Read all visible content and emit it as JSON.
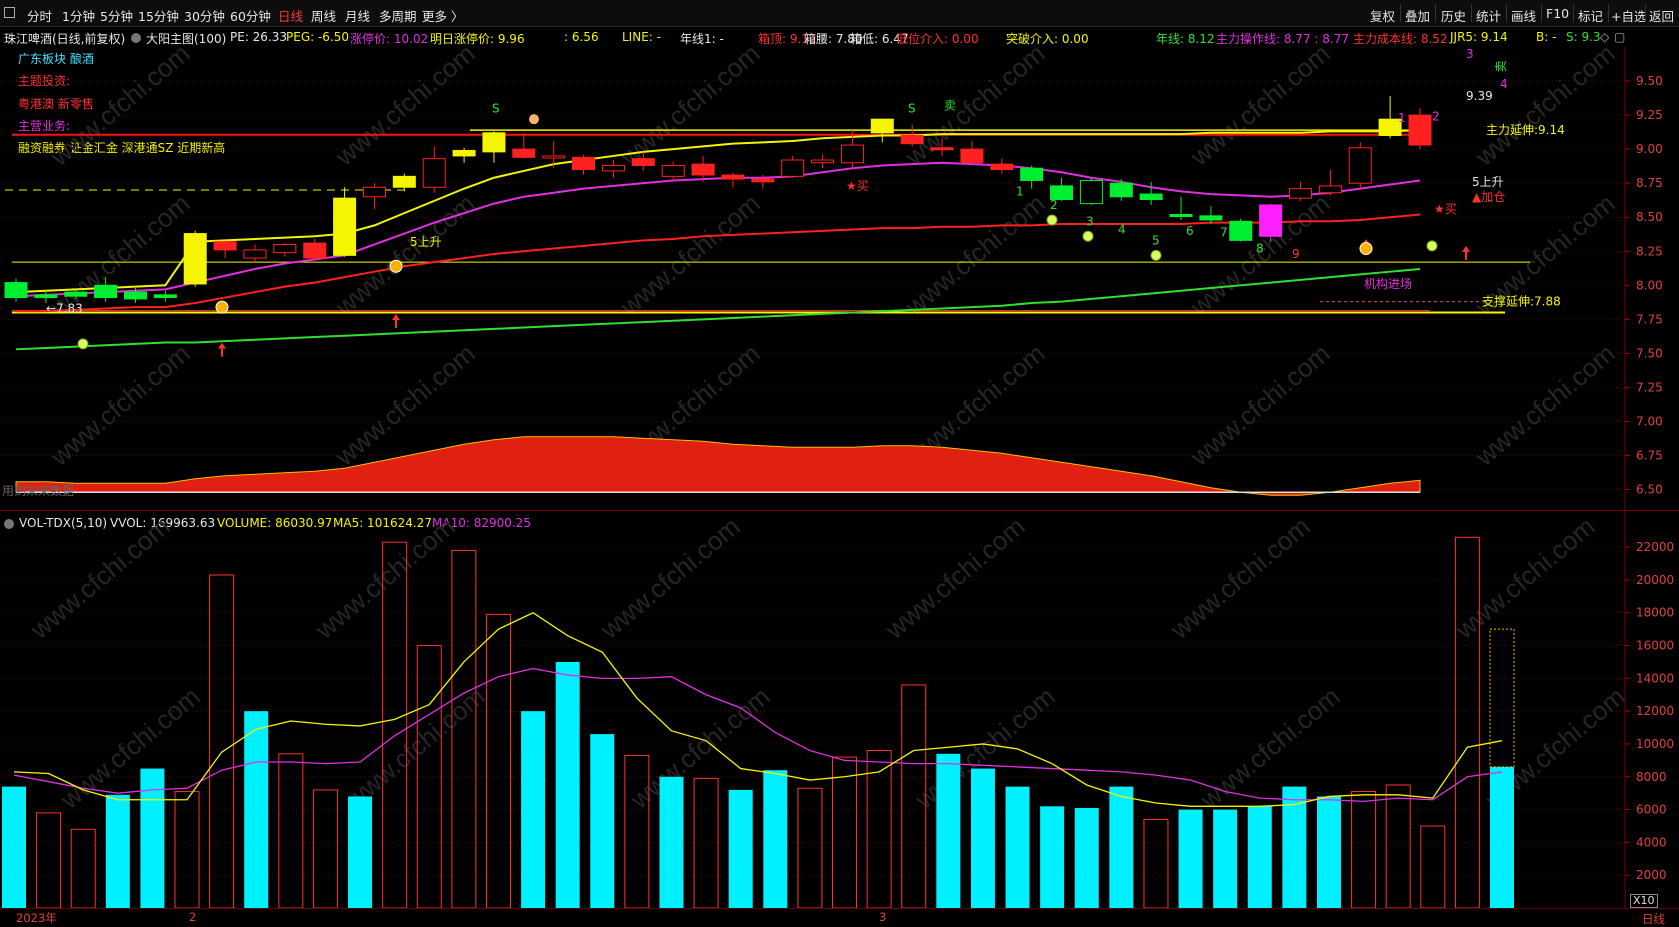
{
  "toolbar": {
    "periods": [
      "分时",
      "1分钟",
      "5分钟",
      "15分钟",
      "30分钟",
      "60分钟",
      "日线",
      "周线",
      "月线",
      "多周期",
      "更多 〉"
    ],
    "active_period": "日线",
    "right": [
      "复权",
      "叠加",
      "历史",
      "统计",
      "画线",
      "F10",
      "标记",
      "+自选",
      "返回"
    ]
  },
  "info": {
    "stock": "珠江啤酒(日线,前复权)",
    "indicator": "大阳主图(100)",
    "pe": "PE: 26.33",
    "peg": "PEG: -6.50",
    "limit_up": "涨停价: 10.02",
    "tomorrow_limit_up": "明日涨停价: 9.96",
    "val656": ": 6.56",
    "line": "LINE: -",
    "year_line1": "年线1: -",
    "box_top": "箱顶: 9.12",
    "box_mid": "箱腰: 7.80",
    "box_low": "箱低: 6.47",
    "low_entry": "低位介入: 0.00",
    "break_entry": "突破介入: 0.00",
    "year_line": "年线: 8.12",
    "main_op_line": "主力操作线: 8.77 : 8.77",
    "main_cost_line": "主力成本线: 8.52",
    "jjr5": "JJR5: 9.14",
    "b": "B: -",
    "s": "S: 9.3"
  },
  "side_labels": {
    "sector": "广东板块  酿酒",
    "theme_title": "主题投资:",
    "theme_value": "粤港澳  新零售",
    "business_title": "主营业务:",
    "business_value": "融资融券  证金汇金  深港通SZ  近期新高"
  },
  "annotations": {
    "left_price": "←7.83",
    "rise5_left": "5上升",
    "rise5_right": "5上升",
    "top_price": "9.39",
    "main_ext": "主力延伸:9.14",
    "support_ext": "支撑延伸:7.88",
    "inst_entry": "机构进场",
    "add_pos": "▲加仓",
    "buy": "★买",
    "sell": "卖",
    "s_mark": "S",
    "no_future": "用到未来数据",
    "seq": [
      "1",
      "2",
      "3",
      "4",
      "5",
      "6",
      "7",
      "8",
      "9"
    ],
    "seq_top": [
      "1",
      "2",
      "3",
      "4"
    ]
  },
  "volume_header": {
    "title": "VOL-TDX(5,10)",
    "vvol": "VVOL: 169963.63",
    "volume": "VOLUME: 86030.97",
    "ma5": "MA5: 101624.27",
    "ma10": "MA10: 82900.25"
  },
  "bottom": {
    "year": "2023年",
    "m2": "2",
    "m3": "3",
    "x10": "X10",
    "period": "日线"
  },
  "colors": {
    "up": "#ff3030",
    "down": "#00ff3c",
    "vol_up": "#ff3030",
    "vol_down": "#00f0ff",
    "ma_yellow": "#f5f500",
    "ma_magenta": "#e030e0",
    "ma_red": "#ff2020",
    "ma_green": "#30e030",
    "grid": "#5a0000"
  },
  "chart_data": [
    {
      "type": "candlestick",
      "title": "大阳主图(100)",
      "ylim": [
        6.35,
        9.75
      ],
      "y_ticks": [
        6.5,
        6.75,
        7.0,
        7.25,
        7.5,
        7.75,
        8.0,
        8.25,
        8.5,
        8.75,
        9.0,
        9.25,
        9.5
      ],
      "candles": [
        {
          "o": 8.02,
          "h": 8.05,
          "c": 7.91,
          "l": 7.88,
          "style": "green"
        },
        {
          "o": 7.93,
          "h": 7.96,
          "c": 7.91,
          "l": 7.87,
          "style": "green"
        },
        {
          "o": 7.95,
          "h": 7.97,
          "c": 7.92,
          "l": 7.9,
          "style": "green"
        },
        {
          "o": 8.0,
          "h": 8.06,
          "c": 7.91,
          "l": 7.88,
          "style": "green"
        },
        {
          "o": 7.95,
          "h": 7.99,
          "c": 7.9,
          "l": 7.87,
          "style": "green"
        },
        {
          "o": 7.93,
          "h": 7.96,
          "c": 7.91,
          "l": 7.88,
          "style": "green"
        },
        {
          "o": 8.01,
          "h": 8.4,
          "c": 8.38,
          "l": 7.99,
          "style": "yellow"
        },
        {
          "o": 8.26,
          "h": 8.31,
          "c": 8.32,
          "l": 8.2,
          "style": "red"
        },
        {
          "o": 8.2,
          "h": 8.3,
          "c": 8.26,
          "l": 8.17,
          "style": "hollow"
        },
        {
          "o": 8.24,
          "h": 8.31,
          "c": 8.3,
          "l": 8.21,
          "style": "hollow"
        },
        {
          "o": 8.2,
          "h": 8.34,
          "c": 8.31,
          "l": 8.18,
          "style": "red"
        },
        {
          "o": 8.22,
          "h": 8.72,
          "c": 8.64,
          "l": 8.21,
          "style": "yellow"
        },
        {
          "o": 8.65,
          "h": 8.75,
          "c": 8.72,
          "l": 8.56,
          "style": "hollow"
        },
        {
          "o": 8.72,
          "h": 8.82,
          "c": 8.8,
          "l": 8.69,
          "style": "yellow"
        },
        {
          "o": 8.72,
          "h": 9.02,
          "c": 8.93,
          "l": 8.68,
          "style": "hollow"
        },
        {
          "o": 8.95,
          "h": 9.01,
          "c": 8.99,
          "l": 8.9,
          "style": "yellow"
        },
        {
          "o": 8.98,
          "h": 9.13,
          "c": 9.12,
          "l": 8.9,
          "style": "yellow"
        },
        {
          "o": 9.0,
          "h": 9.12,
          "c": 8.94,
          "l": 8.93,
          "style": "red"
        },
        {
          "o": 8.94,
          "h": 9.06,
          "c": 8.95,
          "l": 8.86,
          "style": "hollow"
        },
        {
          "o": 8.94,
          "h": 8.96,
          "c": 8.85,
          "l": 8.81,
          "style": "red"
        },
        {
          "o": 8.84,
          "h": 8.92,
          "c": 8.88,
          "l": 8.79,
          "style": "hollow"
        },
        {
          "o": 8.88,
          "h": 8.98,
          "c": 8.93,
          "l": 8.84,
          "style": "red"
        },
        {
          "o": 8.8,
          "h": 8.91,
          "c": 8.88,
          "l": 8.78,
          "style": "hollow"
        },
        {
          "o": 8.89,
          "h": 8.95,
          "c": 8.81,
          "l": 8.76,
          "style": "red"
        },
        {
          "o": 8.81,
          "h": 8.83,
          "c": 8.78,
          "l": 8.72,
          "style": "red"
        },
        {
          "o": 8.78,
          "h": 8.81,
          "c": 8.76,
          "l": 8.71,
          "style": "red"
        },
        {
          "o": 8.8,
          "h": 8.95,
          "c": 8.92,
          "l": 8.79,
          "style": "hollow"
        },
        {
          "o": 8.9,
          "h": 8.96,
          "c": 8.92,
          "l": 8.86,
          "style": "hollow"
        },
        {
          "o": 8.9,
          "h": 9.14,
          "c": 9.03,
          "l": 8.86,
          "style": "hollow"
        },
        {
          "o": 9.12,
          "h": 9.22,
          "c": 9.22,
          "l": 9.05,
          "style": "yellow"
        },
        {
          "o": 9.1,
          "h": 9.18,
          "c": 9.04,
          "l": 9.02,
          "style": "red"
        },
        {
          "o": 9.01,
          "h": 9.08,
          "c": 9.0,
          "l": 8.95,
          "style": "red"
        },
        {
          "o": 9.0,
          "h": 9.06,
          "c": 8.9,
          "l": 8.89,
          "style": "red"
        },
        {
          "o": 8.89,
          "h": 8.93,
          "c": 8.85,
          "l": 8.82,
          "style": "red"
        },
        {
          "o": 8.86,
          "h": 8.88,
          "c": 8.77,
          "l": 8.71,
          "style": "green"
        },
        {
          "o": 8.73,
          "h": 8.79,
          "c": 8.63,
          "l": 8.62,
          "style": "green"
        },
        {
          "o": 8.6,
          "h": 8.79,
          "c": 8.77,
          "l": 8.59,
          "style": "hollowgreen"
        },
        {
          "o": 8.75,
          "h": 8.78,
          "c": 8.65,
          "l": 8.62,
          "style": "green"
        },
        {
          "o": 8.67,
          "h": 8.76,
          "c": 8.63,
          "l": 8.59,
          "style": "green"
        },
        {
          "o": 8.52,
          "h": 8.65,
          "c": 8.51,
          "l": 8.48,
          "style": "green"
        },
        {
          "o": 8.51,
          "h": 8.58,
          "c": 8.48,
          "l": 8.45,
          "style": "green"
        },
        {
          "o": 8.47,
          "h": 8.49,
          "c": 8.33,
          "l": 8.32,
          "style": "green"
        },
        {
          "o": 8.36,
          "h": 8.6,
          "c": 8.59,
          "l": 8.32,
          "style": "magenta"
        },
        {
          "o": 8.64,
          "h": 8.76,
          "c": 8.71,
          "l": 8.62,
          "style": "hollow"
        },
        {
          "o": 8.68,
          "h": 8.85,
          "c": 8.73,
          "l": 8.66,
          "style": "hollow"
        },
        {
          "o": 8.75,
          "h": 9.05,
          "c": 9.01,
          "l": 8.7,
          "style": "hollow"
        },
        {
          "o": 9.1,
          "h": 9.39,
          "c": 9.22,
          "l": 9.08,
          "style": "yellow"
        },
        {
          "o": 9.25,
          "h": 9.3,
          "c": 9.03,
          "l": 9.0,
          "style": "red"
        }
      ],
      "ma_yellow": [
        7.95,
        7.96,
        7.97,
        7.98,
        7.99,
        8.0,
        8.32,
        8.33,
        8.34,
        8.35,
        8.36,
        8.38,
        8.44,
        8.53,
        8.62,
        8.71,
        8.79,
        8.84,
        8.89,
        8.92,
        8.95,
        8.98,
        9.0,
        9.02,
        9.04,
        9.05,
        9.06,
        9.08,
        9.09,
        9.1,
        9.1,
        9.11,
        9.11,
        9.11,
        9.11,
        9.11,
        9.11,
        9.11,
        9.11,
        9.11,
        9.12,
        9.12,
        9.12,
        9.12,
        9.13,
        9.13,
        9.13,
        9.14
      ],
      "ma_magenta": [
        7.92,
        7.93,
        7.94,
        7.95,
        7.96,
        7.97,
        8.02,
        8.07,
        8.12,
        8.16,
        8.19,
        8.22,
        8.3,
        8.38,
        8.46,
        8.53,
        8.6,
        8.65,
        8.68,
        8.71,
        8.73,
        8.75,
        8.77,
        8.78,
        8.79,
        8.79,
        8.8,
        8.83,
        8.86,
        8.88,
        8.89,
        8.9,
        8.89,
        8.88,
        8.86,
        8.83,
        8.79,
        8.76,
        8.72,
        8.69,
        8.67,
        8.66,
        8.65,
        8.66,
        8.68,
        8.71,
        8.74,
        8.77
      ],
      "ma_red": [
        7.81,
        7.81,
        7.82,
        7.83,
        7.84,
        7.84,
        7.87,
        7.91,
        7.95,
        7.99,
        8.02,
        8.06,
        8.1,
        8.14,
        8.17,
        8.2,
        8.23,
        8.25,
        8.27,
        8.29,
        8.31,
        8.33,
        8.34,
        8.36,
        8.37,
        8.38,
        8.39,
        8.4,
        8.41,
        8.42,
        8.42,
        8.43,
        8.43,
        8.44,
        8.44,
        8.45,
        8.45,
        8.45,
        8.45,
        8.45,
        8.46,
        8.46,
        8.46,
        8.47,
        8.47,
        8.48,
        8.5,
        8.52
      ],
      "ma_green": [
        7.53,
        7.54,
        7.55,
        7.56,
        7.57,
        7.58,
        7.58,
        7.59,
        7.6,
        7.61,
        7.62,
        7.63,
        7.64,
        7.65,
        7.66,
        7.67,
        7.68,
        7.69,
        7.7,
        7.71,
        7.72,
        7.73,
        7.74,
        7.75,
        7.76,
        7.77,
        7.78,
        7.79,
        7.8,
        7.81,
        7.82,
        7.83,
        7.84,
        7.85,
        7.87,
        7.88,
        7.9,
        7.92,
        7.94,
        7.96,
        7.98,
        8.0,
        8.02,
        8.04,
        8.06,
        8.08,
        8.1,
        8.12
      ],
      "hlines": {
        "box_top": 9.12,
        "support": 7.8,
        "ext_yellow": 9.14,
        "mid": 8.17,
        "dashed_left": 8.7,
        "support_dash": 7.88
      },
      "area": [
        0.07,
        0.07,
        0.06,
        0.06,
        0.06,
        0.06,
        0.09,
        0.11,
        0.12,
        0.13,
        0.14,
        0.16,
        0.2,
        0.24,
        0.28,
        0.32,
        0.35,
        0.37,
        0.37,
        0.37,
        0.37,
        0.36,
        0.35,
        0.34,
        0.32,
        0.31,
        0.3,
        0.3,
        0.3,
        0.31,
        0.31,
        0.3,
        0.28,
        0.26,
        0.23,
        0.2,
        0.17,
        0.14,
        0.11,
        0.07,
        0.03,
        0.0,
        -0.02,
        -0.02,
        0.0,
        0.03,
        0.06,
        0.08
      ]
    },
    {
      "type": "bar",
      "title": "VOL-TDX(5,10)",
      "ylim": [
        0,
        22800
      ],
      "y_ticks": [
        2000,
        4000,
        6000,
        8000,
        10000,
        12000,
        14000,
        16000,
        18000,
        20000,
        22000
      ],
      "values": [
        7400,
        5800,
        4800,
        6900,
        8500,
        7100,
        20300,
        12000,
        9400,
        7200,
        6800,
        22300,
        16000,
        21800,
        17900,
        12000,
        15000,
        10600,
        9300,
        8000,
        7900,
        7200,
        8400,
        7300,
        9200,
        9600,
        13600,
        9400,
        8500,
        7400,
        6200,
        6100,
        7400,
        5400,
        6000,
        6000,
        6200,
        7400,
        6800,
        7100,
        7500,
        5000,
        22600,
        8600
      ],
      "colors": [
        "down",
        "up",
        "up",
        "down",
        "down",
        "up",
        "up",
        "down",
        "up",
        "up",
        "down",
        "up",
        "up",
        "up",
        "up",
        "down",
        "down",
        "down",
        "up",
        "down",
        "up",
        "down",
        "down",
        "up",
        "up",
        "up",
        "up",
        "down",
        "down",
        "down",
        "down",
        "down",
        "down",
        "up",
        "down",
        "down",
        "down",
        "down",
        "down",
        "up",
        "up",
        "up",
        "up",
        "down"
      ],
      "ma5": [
        8300,
        8200,
        7200,
        6600,
        6600,
        6600,
        9500,
        10900,
        11400,
        11200,
        11100,
        11500,
        12400,
        15000,
        17000,
        18000,
        16600,
        15600,
        12800,
        10800,
        10200,
        8500,
        8200,
        7800,
        8000,
        8300,
        9600,
        9800,
        10000,
        9700,
        8800,
        7500,
        6800,
        6400,
        6200,
        6200,
        6200,
        6300,
        6800,
        6900,
        6900,
        6700,
        9800,
        10200
      ],
      "ma10": [
        8100,
        7700,
        7300,
        7000,
        7200,
        7300,
        8400,
        8900,
        8900,
        8800,
        8900,
        10500,
        11800,
        13100,
        14100,
        14600,
        14200,
        14000,
        14000,
        14100,
        13000,
        12200,
        10700,
        9600,
        9000,
        8900,
        8800,
        8800,
        8700,
        8600,
        8500,
        8400,
        8300,
        8100,
        7800,
        7100,
        6700,
        6600,
        6600,
        6500,
        6700,
        6600,
        8000,
        8300
      ],
      "future_bar": 17000
    }
  ]
}
